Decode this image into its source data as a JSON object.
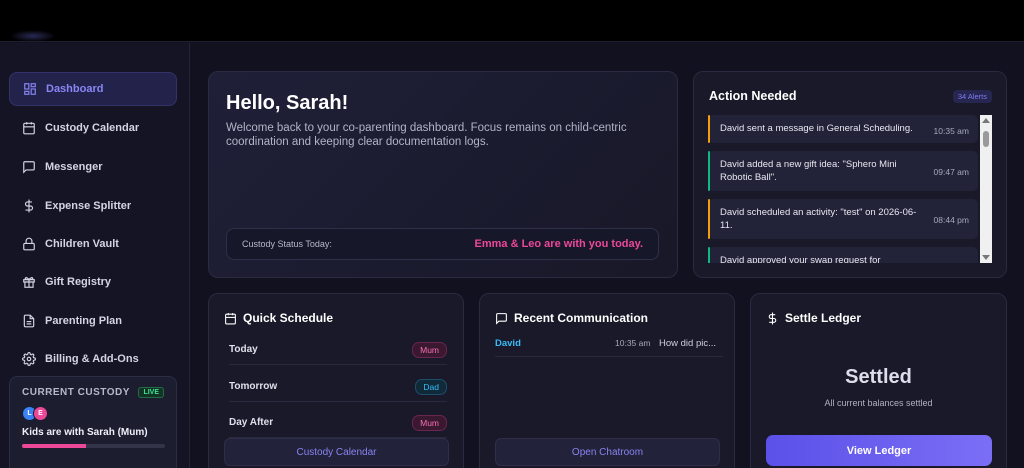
{
  "sidebar": {
    "items": [
      {
        "label": "Dashboard",
        "icon": "dashboard-icon",
        "active": true
      },
      {
        "label": "Custody Calendar",
        "icon": "calendar-icon"
      },
      {
        "label": "Messenger",
        "icon": "message-icon"
      },
      {
        "label": "Expense Splitter",
        "icon": "dollar-icon"
      },
      {
        "label": "Children Vault",
        "icon": "lock-icon"
      },
      {
        "label": "Gift Registry",
        "icon": "gift-icon"
      },
      {
        "label": "Parenting Plan",
        "icon": "document-icon"
      },
      {
        "label": "Billing & Add-Ons",
        "icon": "gear-icon"
      }
    ],
    "custody": {
      "title": "CURRENT CUSTODY",
      "live": "LIVE",
      "avatars": [
        "L",
        "E"
      ],
      "text": "Kids are with Sarah (Mum)",
      "progress": 0.45
    }
  },
  "hero": {
    "title": "Hello, Sarah!",
    "subtitle": "Welcome back to your co-parenting dashboard. Focus remains on child-centric coordination and keeping clear documentation logs.",
    "status_label": "Custody Status Today:",
    "status_value": "Emma & Leo are with you today."
  },
  "action": {
    "title": "Action Needed",
    "badge": "34 Alerts",
    "alerts": [
      {
        "msg": "David sent a message in General Scheduling.",
        "time": "10:35 am",
        "color": "#f59e0b"
      },
      {
        "msg": "David added a new gift idea: \"Sphero Mini Robotic Ball\".",
        "time": "09:47 am",
        "color": "#10b981"
      },
      {
        "msg": "David scheduled an activity: \"test\" on 2026-06-11.",
        "time": "08:44 pm",
        "color": "#f59e0b"
      },
      {
        "msg": "David approved your swap request for",
        "time": "",
        "color": "#10b981"
      }
    ]
  },
  "schedule": {
    "title": "Quick Schedule",
    "rows": [
      {
        "day": "Today",
        "parent": "Mum"
      },
      {
        "day": "Tomorrow",
        "parent": "Dad"
      },
      {
        "day": "Day After",
        "parent": "Mum"
      }
    ],
    "button": "Custody Calendar"
  },
  "communication": {
    "title": "Recent Communication",
    "messages": [
      {
        "from": "David",
        "time": "10:35 am",
        "preview": "How did pic..."
      }
    ],
    "button": "Open Chatroom"
  },
  "ledger": {
    "title": "Settle Ledger",
    "status": "Settled",
    "sub": "All current balances settled",
    "button": "View Ledger"
  },
  "colors": {
    "accent": "#7b6ef6",
    "pink": "#ec4899",
    "cyan": "#38bdf8",
    "bg": "#11111f"
  }
}
